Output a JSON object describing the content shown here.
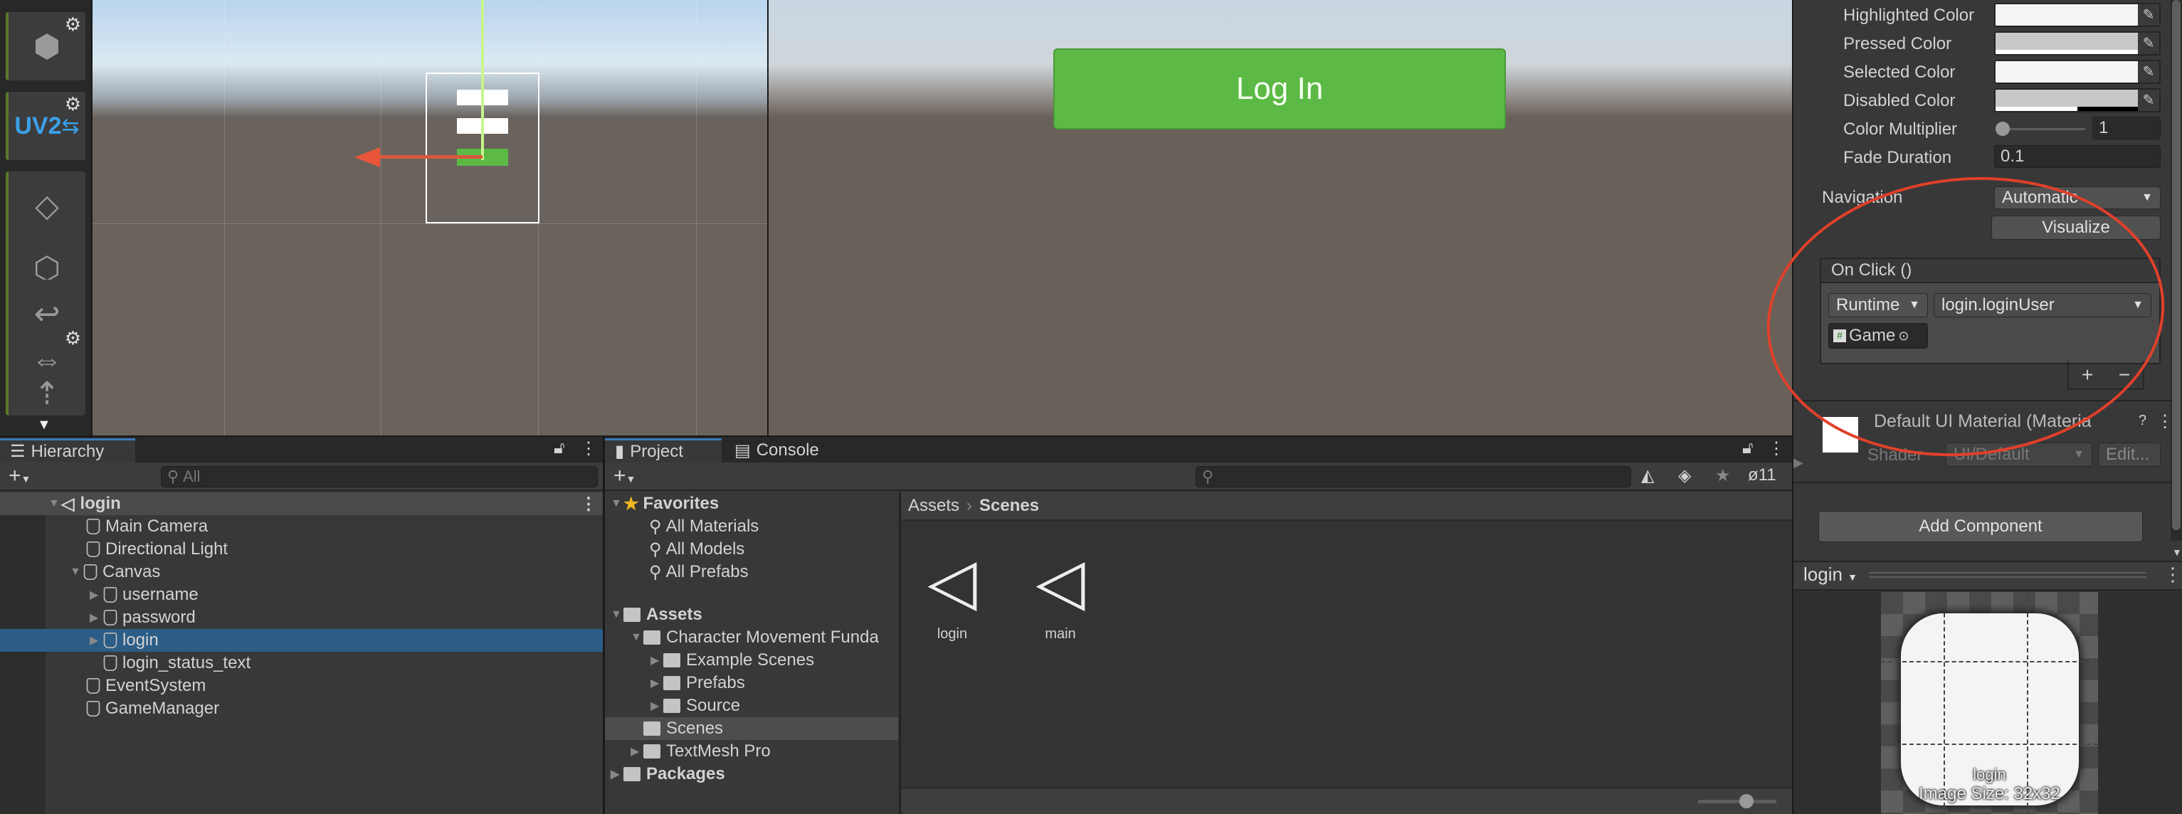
{
  "toolbar": {
    "tools": [
      "probuilder-shape-icon",
      "uv2-unwrap-icon",
      "new-poly-shape-icon",
      "smoothing-icon",
      "material-editor-icon",
      "vertex-colors-icon",
      "flip-normals-icon",
      "mirror-icon",
      "merge-icon"
    ],
    "uv2_label": "UV2"
  },
  "game_view": {
    "button_label": "Log In",
    "button_color": "#5cb946"
  },
  "inspector": {
    "color_rows": [
      {
        "label": "Highlighted Color",
        "color": "#f5f5f5"
      },
      {
        "label": "Pressed Color",
        "color": "#c8c8c8"
      },
      {
        "label": "Selected Color",
        "color": "#f5f5f5"
      },
      {
        "label": "Disabled Color",
        "color": "#c8c8c8"
      }
    ],
    "color_multiplier": {
      "label": "Color Multiplier",
      "value": "1"
    },
    "fade_duration": {
      "label": "Fade Duration",
      "value": "0.1"
    },
    "navigation": {
      "label": "Navigation",
      "value": "Automatic"
    },
    "visualize_label": "Visualize",
    "on_click": {
      "title": "On Click ()",
      "runtime": "Runtime",
      "function": "login.loginUser",
      "object": "Game",
      "add": "+",
      "remove": "−"
    },
    "material": {
      "name": "Default UI Material (Materia",
      "shader_label": "Shader",
      "shader": "UI/Default",
      "edit": "Edit..."
    },
    "add_component": "Add Component",
    "preview": {
      "name": "login",
      "caption_name": "login",
      "caption_size": "Image Size: 32x32"
    }
  },
  "hierarchy": {
    "tab": "Hierarchy",
    "search_placeholder": "All",
    "scene": "login",
    "items": [
      {
        "label": "Main Camera"
      },
      {
        "label": "Directional Light"
      },
      {
        "label": "Canvas"
      },
      {
        "label": "username"
      },
      {
        "label": "password"
      },
      {
        "label": "login"
      },
      {
        "label": "login_status_text"
      },
      {
        "label": "EventSystem"
      },
      {
        "label": "GameManager"
      }
    ]
  },
  "project": {
    "tabs": [
      "Project",
      "Console"
    ],
    "hidden_count": "11",
    "tree": {
      "favorites": "Favorites",
      "fav_items": [
        "All Materials",
        "All Models",
        "All Prefabs"
      ],
      "assets": "Assets",
      "char": "Character Movement Funda",
      "sub": [
        "Example Scenes",
        "Prefabs",
        "Source"
      ],
      "scenes": "Scenes",
      "tmp": "TextMesh Pro",
      "packages": "Packages"
    },
    "breadcrumb": [
      "Assets",
      "Scenes"
    ],
    "files": [
      "login",
      "main"
    ]
  }
}
